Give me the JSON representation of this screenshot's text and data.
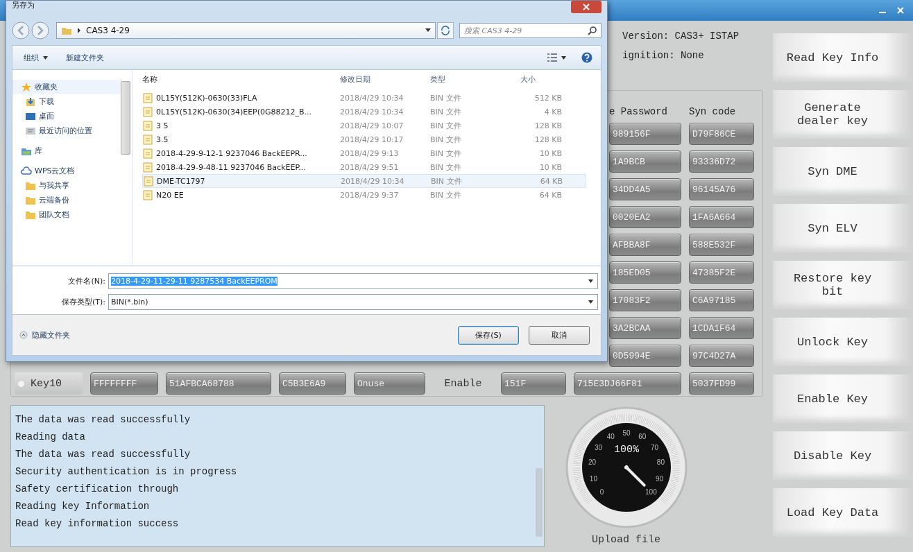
{
  "app": {
    "info": [
      "Version: CAS3+ ISTAP",
      "ignition: None"
    ],
    "table": {
      "headers": [
        "e Password",
        "Syn code"
      ],
      "rows": [
        {
          "cells": [
            "989156F",
            "D79F86CE"
          ]
        },
        {
          "cells": [
            "1A9BCB",
            "93336D72"
          ]
        },
        {
          "cells": [
            "34DD4A5",
            "96145A76"
          ]
        },
        {
          "cells": [
            "0020EA2",
            "1FA6A664"
          ]
        },
        {
          "cells": [
            "AFBBA8F",
            "588E532F"
          ]
        },
        {
          "cells": [
            "185ED05",
            "47385F2E"
          ]
        },
        {
          "cells": [
            "17083F2",
            "C6A97185"
          ]
        },
        {
          "cells": [
            "3A2BCAA",
            "1CDA1F64"
          ]
        },
        {
          "cells": [
            "0D5994E",
            "97C4D27A"
          ]
        }
      ],
      "last_row": {
        "label": "Key10",
        "selected": false,
        "cells": [
          "FFFFFFFF",
          "51AFBCA68788",
          "C5B3E6A9",
          "Onuse"
        ],
        "status": "Enable",
        "tail": [
          "151F",
          "715E3DJ66F81",
          "5037FD99"
        ]
      }
    },
    "log": [
      "The data was read successfully",
      "Reading data",
      "The data was read successfully",
      "Security authentication is in progress",
      "Safety certification through",
      "Reading key Information",
      "Read key information success"
    ],
    "gauge": {
      "level": 1,
      "reading": "100%",
      "label": "Upload file",
      "dial_labels": [
        "0",
        "10",
        "20",
        "30",
        "40",
        "50",
        "60",
        "70",
        "80",
        "90",
        "100"
      ]
    },
    "buttons": [
      "Read Key Info",
      "Generate dealer key",
      "Syn DME",
      "Syn ELV",
      "Restore key bit",
      "Unlock Key",
      "Enable Key",
      "Disable Key",
      "Load Key Data"
    ]
  },
  "dialog": {
    "title": "另存为",
    "path": "CAS3 4-29",
    "search": {
      "placeholder": "搜索 CAS3 4-29"
    },
    "toolbar": [
      {
        "label": "组织",
        "kind": "menu"
      },
      {
        "label": "新建文件夹",
        "kind": "button"
      }
    ],
    "sidebar": [
      {
        "label": "收藏夹",
        "kind": "star",
        "selected": true,
        "children": [
          {
            "label": "下载",
            "kind": "download",
            "selected": false
          },
          {
            "label": "桌面",
            "kind": "desktop",
            "selected": false
          },
          {
            "label": "最近访问的位置",
            "kind": "recent",
            "selected": false
          }
        ]
      },
      {
        "label": "库",
        "kind": "library",
        "selected": false
      },
      {
        "label": "WPS云文档",
        "kind": "cloud",
        "selected": false,
        "children": [
          {
            "label": "与我共享",
            "kind": "folder",
            "selected": false
          },
          {
            "label": "云端备份",
            "kind": "folder",
            "selected": false
          },
          {
            "label": "团队文档",
            "kind": "folder",
            "selected": false
          }
        ]
      }
    ],
    "columns": [
      "名称",
      "修改日期",
      "类型",
      "大小"
    ],
    "files": [
      {
        "name": "0L15Y(512K)-0630(33)FLA",
        "modified": "2018/4/29 10:34",
        "type": "BIN 文件",
        "size": "512 KB",
        "selected": false
      },
      {
        "name": "0L15Y(512K)-0630(34)EEP(0G88212_B...",
        "modified": "2018/4/29 10:34",
        "type": "BIN 文件",
        "size": "4 KB",
        "selected": false
      },
      {
        "name": "3   5",
        "modified": "2018/4/29 10:07",
        "type": "BIN 文件",
        "size": "128 KB",
        "selected": false
      },
      {
        "name": "3.5",
        "modified": "2018/4/29 10:17",
        "type": "BIN 文件",
        "size": "128 KB",
        "selected": false
      },
      {
        "name": "2018-4-29-9-12-1 9237046 BackEEPR...",
        "modified": "2018/4/29 9:13",
        "type": "BIN 文件",
        "size": "10 KB",
        "selected": false
      },
      {
        "name": "2018-4-29-9-48-11 9237046 BackEEP...",
        "modified": "2018/4/29 9:51",
        "type": "BIN 文件",
        "size": "10 KB",
        "selected": false
      },
      {
        "name": "DME-TC1797",
        "modified": "2018/4/29 10:34",
        "type": "BIN 文件",
        "size": "64 KB",
        "selected": true
      },
      {
        "name": "N20 EE",
        "modified": "2018/4/29 9:37",
        "type": "BIN 文件",
        "size": "64 KB",
        "selected": false
      }
    ],
    "filename": {
      "label": "文件名(N):",
      "value": "2018-4-29-11-29-11 9287534 BackEEPROM",
      "selected": true
    },
    "filetype": {
      "label": "保存类型(T):",
      "value": "BIN(*.bin)"
    },
    "hide_folders": "隐藏文件夹",
    "buttons": [
      {
        "label": "保存(S)",
        "default": true
      },
      {
        "label": "取消",
        "default": false
      }
    ]
  }
}
